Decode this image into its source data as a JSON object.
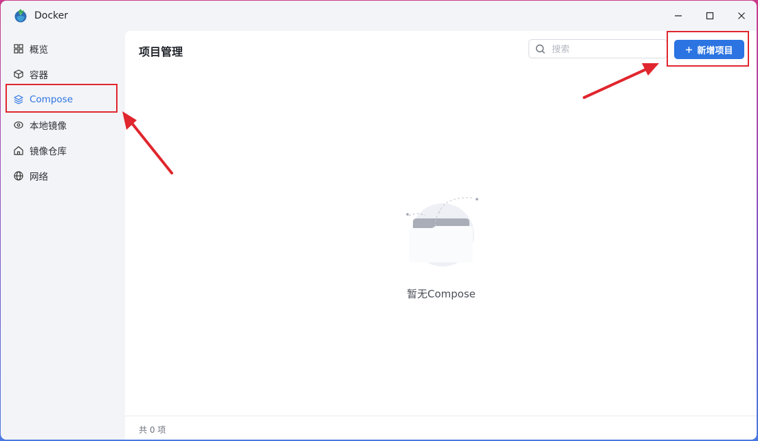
{
  "window": {
    "title": "Docker"
  },
  "sidebar": {
    "items": [
      {
        "label": "概览",
        "icon": "dashboard-grid-icon"
      },
      {
        "label": "容器",
        "icon": "cube-icon"
      },
      {
        "label": "Compose",
        "icon": "layers-icon",
        "active": true
      },
      {
        "label": "本地镜像",
        "icon": "disk-image-icon"
      },
      {
        "label": "镜像仓库",
        "icon": "house-icon"
      },
      {
        "label": "网络",
        "icon": "globe-icon"
      }
    ]
  },
  "main": {
    "title": "项目管理",
    "search": {
      "placeholder": "搜索",
      "value": ""
    },
    "add_button": {
      "label": "新增项目",
      "icon": "plus-icon"
    },
    "empty_state": {
      "text": "暂无Compose",
      "icon": "empty-folder-icon"
    },
    "footer": {
      "total": "共 0 项"
    }
  },
  "colors": {
    "accent": "#2b74e2",
    "annotation": "#e0262e",
    "sidebar_bg": "#f3f4f7",
    "content_bg": "#ffffff"
  }
}
